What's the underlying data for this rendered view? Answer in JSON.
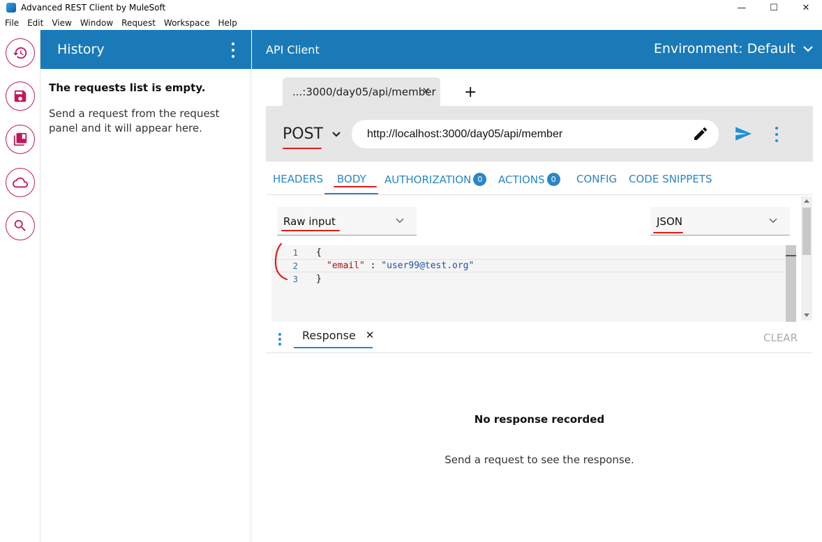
{
  "window": {
    "title": "Advanced REST Client by MuleSoft",
    "controls": [
      "—",
      "☐",
      "✕"
    ]
  },
  "menu": [
    "File",
    "Edit",
    "View",
    "Window",
    "Request",
    "Workspace",
    "Help"
  ],
  "rail": {
    "icons": [
      "history-icon",
      "save-icon",
      "library-icon",
      "cloud-icon",
      "search-icon"
    ],
    "accent": "#c2185b"
  },
  "history": {
    "title": "History",
    "empty_title": "The requests list is empty.",
    "empty_text": "Send a request from the request panel and it will appear here."
  },
  "header": {
    "title": "API Client",
    "environment": "Environment: Default",
    "color": "#1a7ab8"
  },
  "request": {
    "tab_label": "...:3000/day05/api/member",
    "tab_close": "×",
    "add_tab": "+",
    "method": "POST",
    "url": "http://localhost:3000/day05/api/member"
  },
  "body_tabs": {
    "headers": "HEADERS",
    "body": "BODY",
    "authorization": "AUTHORIZATION",
    "authorization_count": "0",
    "actions": "ACTIONS",
    "actions_count": "0",
    "config": "CONFIG",
    "code_snippets": "CODE SNIPPETS",
    "active": "BODY"
  },
  "editor": {
    "mode": "Raw input",
    "content_type": "JSON",
    "lines": [
      {
        "num": "1",
        "text": "{"
      },
      {
        "num": "2",
        "key": "\"email\"",
        "sep": " : ",
        "value": "\"user99@test.org\""
      },
      {
        "num": "3",
        "text": "}"
      }
    ]
  },
  "response": {
    "tab_label": "Response",
    "tab_close": "✕",
    "clear": "CLEAR",
    "empty_title": "No response recorded",
    "empty_text": "Send a request to see the response."
  }
}
